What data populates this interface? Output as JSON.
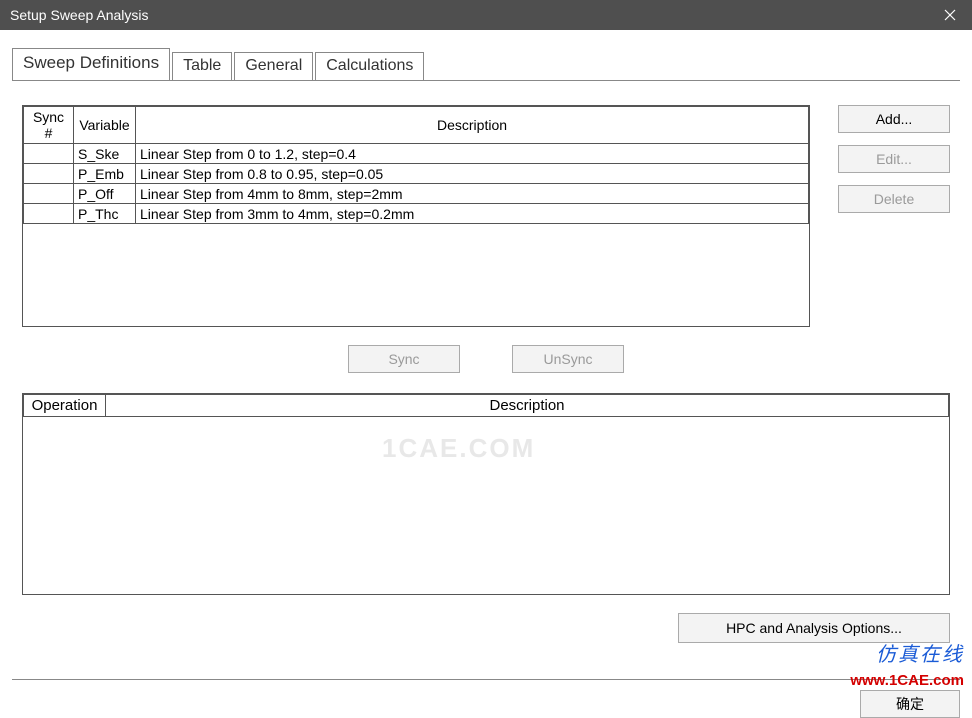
{
  "window": {
    "title": "Setup Sweep Analysis"
  },
  "tabs": [
    {
      "label": "Sweep Definitions",
      "active": true
    },
    {
      "label": "Table",
      "active": false
    },
    {
      "label": "General",
      "active": false
    },
    {
      "label": "Calculations",
      "active": false
    }
  ],
  "sweep_table": {
    "headers": {
      "sync": "Sync #",
      "variable": "Variable",
      "description": "Description"
    },
    "rows": [
      {
        "sync": "",
        "variable": "S_Ske",
        "description": "Linear Step from 0 to 1.2, step=0.4"
      },
      {
        "sync": "",
        "variable": "P_Emb",
        "description": "Linear Step from 0.8 to 0.95, step=0.05"
      },
      {
        "sync": "",
        "variable": "P_Off",
        "description": "Linear Step from 4mm to 8mm, step=2mm"
      },
      {
        "sync": "",
        "variable": "P_Thc",
        "description": "Linear Step from 3mm to 4mm, step=0.2mm"
      }
    ]
  },
  "buttons": {
    "add": "Add...",
    "edit": "Edit...",
    "delete": "Delete",
    "sync": "Sync",
    "unsync": "UnSync",
    "hpc": "HPC and Analysis Options...",
    "ok": "确定"
  },
  "op_table": {
    "headers": {
      "operation": "Operation",
      "description": "Description"
    }
  },
  "watermark": {
    "cn": "仿真在线",
    "url_r": "www.",
    "url_m": "1CAE",
    "url_e": ".com",
    "mid": "1CAE.COM"
  }
}
